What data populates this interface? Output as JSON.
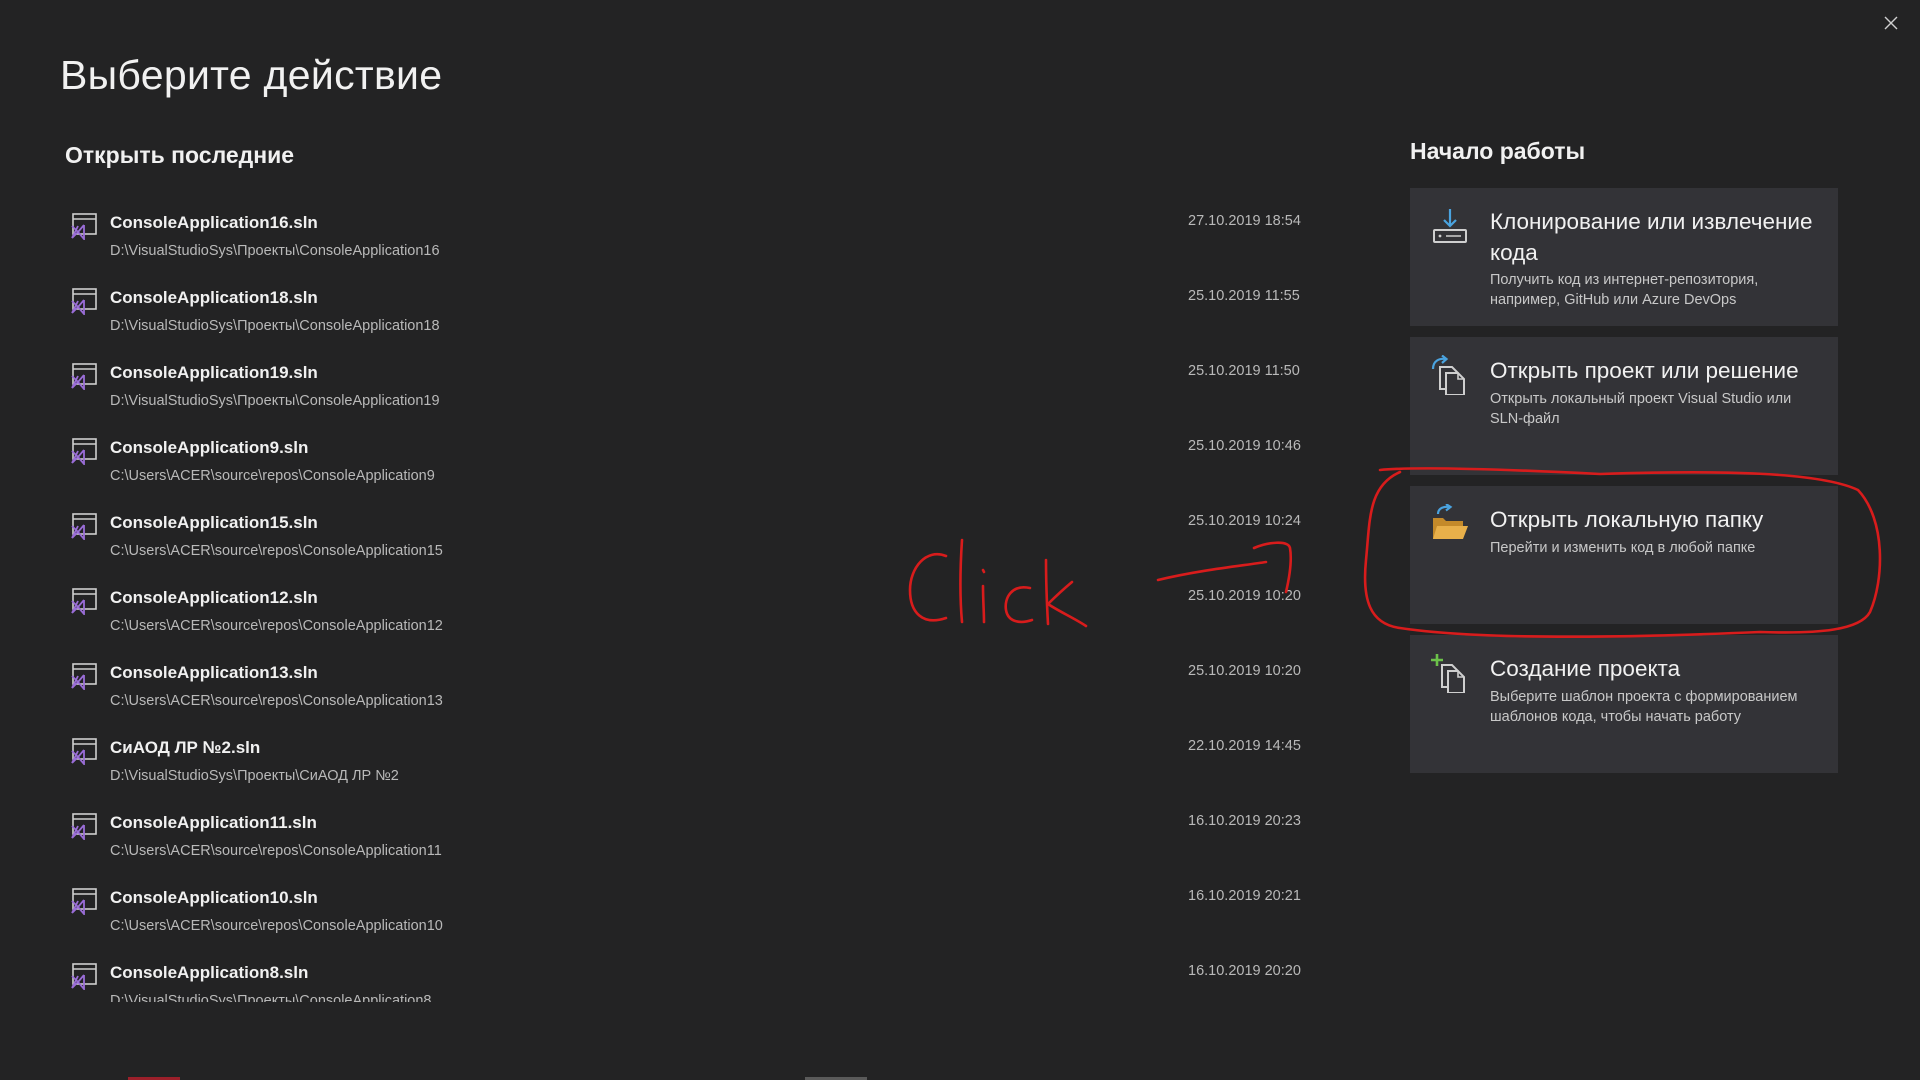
{
  "window": {
    "close_icon": "close-icon"
  },
  "page_title": "Выберите действие",
  "recent": {
    "title": "Открыть последние",
    "items": [
      {
        "name": "ConsoleApplication16.sln",
        "path": "D:\\VisualStudioSys\\Проекты\\ConsoleApplication16",
        "date": "27.10.2019 18:54"
      },
      {
        "name": "ConsoleApplication18.sln",
        "path": "D:\\VisualStudioSys\\Проекты\\ConsoleApplication18",
        "date": "25.10.2019 11:55"
      },
      {
        "name": "ConsoleApplication19.sln",
        "path": "D:\\VisualStudioSys\\Проекты\\ConsoleApplication19",
        "date": "25.10.2019 11:50"
      },
      {
        "name": "ConsoleApplication9.sln",
        "path": "C:\\Users\\ACER\\source\\repos\\ConsoleApplication9",
        "date": "25.10.2019 10:46"
      },
      {
        "name": "ConsoleApplication15.sln",
        "path": "C:\\Users\\ACER\\source\\repos\\ConsoleApplication15",
        "date": "25.10.2019 10:24"
      },
      {
        "name": "ConsoleApplication12.sln",
        "path": "C:\\Users\\ACER\\source\\repos\\ConsoleApplication12",
        "date": "25.10.2019 10:20"
      },
      {
        "name": "ConsoleApplication13.sln",
        "path": "C:\\Users\\ACER\\source\\repos\\ConsoleApplication13",
        "date": "25.10.2019 10:20"
      },
      {
        "name": "СиАОД ЛР №2.sln",
        "path": "D:\\VisualStudioSys\\Проекты\\СиАОД ЛР №2",
        "date": "22.10.2019 14:45"
      },
      {
        "name": "ConsoleApplication11.sln",
        "path": "C:\\Users\\ACER\\source\\repos\\ConsoleApplication11",
        "date": "16.10.2019 20:23"
      },
      {
        "name": "ConsoleApplication10.sln",
        "path": "C:\\Users\\ACER\\source\\repos\\ConsoleApplication10",
        "date": "16.10.2019 20:21"
      },
      {
        "name": "ConsoleApplication8.sln",
        "path": "D:\\VisualStudioSys\\Проекты\\ConsoleApplication8",
        "date": "16.10.2019 20:20"
      }
    ]
  },
  "start": {
    "title": "Начало работы",
    "cards": [
      {
        "icon": "clone-download-icon",
        "title": "Клонирование или извлечение кода",
        "desc": "Получить код из интернет-репозитория, например, GitHub или Azure DevOps"
      },
      {
        "icon": "open-project-icon",
        "title": "Открыть проект или решение",
        "desc": "Открыть локальный проект Visual Studio или SLN-файл"
      },
      {
        "icon": "open-folder-icon",
        "title": "Открыть локальную папку",
        "desc": "Перейти и изменить код в любой папке"
      },
      {
        "icon": "new-project-icon",
        "title": "Создание проекта",
        "desc": "Выберите шаблон проекта с формированием шаблонов кода, чтобы начать работу"
      }
    ]
  },
  "annotation": {
    "text": "Click",
    "color": "#d81c1c"
  },
  "colors": {
    "background": "#232324",
    "card": "#333337",
    "accent_blue": "#4aa3df",
    "folder": "#e8b04a",
    "vs_purple": "#9a6dd7",
    "plus_green": "#6cc24a"
  }
}
